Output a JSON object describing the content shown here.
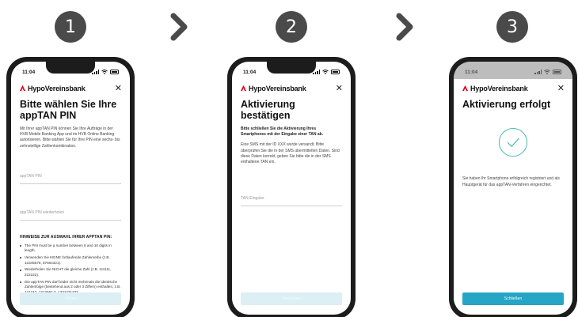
{
  "steps": [
    {
      "number": "1",
      "status": {
        "time": "11:04"
      },
      "brand": "HypoVereinsbank",
      "title": "Bitte wählen Sie Ihre appTAN PIN",
      "intro": "Mit Ihrer appTAN PIN können Sie Ihre Aufträge in der HVB Mobile Banking App und im HVB Online Banking autorisieren. Bitte wählen Sie für Ihre PIN eine sechs- bis zehnstellige Zahlenkombination.",
      "fields": [
        {
          "placeholder": "appTAN PIN"
        },
        {
          "placeholder": "appTAN PIN wiederholen"
        }
      ],
      "hints_title": "HINWEISE ZUR AUSWAHL IHRER APPTAN PIN:",
      "hints": [
        "The PIN must be a number between 6 and 10 digits in length.",
        "Verwenden Sie KEINE fortlaufende Zahlenreihe (z.B. 12345678, 87654321).",
        "Wiederholen Sie NICHT die gleiche Zahl (z.B. 111111, 222222).",
        "Die appTAN PIN darf leider nicht mehrmals die identische Zahlenfolge (bestehend aus 2 oder 3 Ziffern) enthalten, z.B. 121212, 1212561 2, 1231231237."
      ],
      "button": "Weiter"
    },
    {
      "number": "2",
      "status": {
        "time": "11:04"
      },
      "brand": "HypoVereinsbank",
      "title": "Aktivierung bestätigen",
      "intro_bold": "Bitte schließen Sie die Aktivierung Ihres Smartphones mit der Eingabe einer TAN ab.",
      "intro": "Eine SMS mit der ID XXX wurde versandt. Bitte überprüfen Sie die in der SMS übermittelten Daten. Sind diese Daten korrekt, geben Sie bitte die in der SMS enthaltene TAN ein.",
      "field": {
        "placeholder": "TAN-Eingabe"
      },
      "button": "Freigeben"
    },
    {
      "number": "3",
      "status": {
        "time": "11:04"
      },
      "brand": "HypoVereinsbank",
      "title": "Aktivierung erfolgt",
      "message": "Sie haben Ihr Smartphone erfolgreich registriert und als Hauptgerät für das appTAN-Verfahren eingerichtet.",
      "button": "Schließen"
    }
  ],
  "colors": {
    "step_circle": "#4a4a4a",
    "chevron": "#4a4a4a",
    "brand_red": "#e2001a",
    "accent": "#26a6c6",
    "button_disabled": "#dbeff4",
    "check": "#3fb7a6"
  },
  "icons": [
    "chevron-right-icon",
    "close-icon",
    "hvb-logo-icon",
    "signal-icon",
    "wifi-icon",
    "battery-icon",
    "checkmark-circle-icon"
  ]
}
